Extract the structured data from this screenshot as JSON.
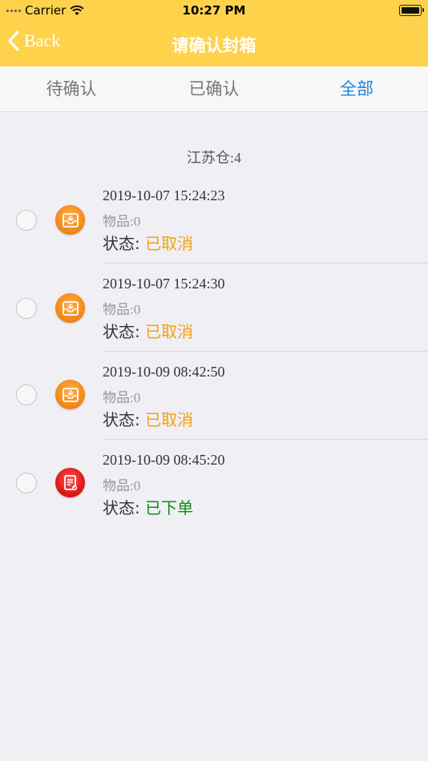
{
  "status_bar": {
    "carrier": "Carrier",
    "time": "10:27 PM"
  },
  "nav": {
    "back_label": "Back",
    "title": "请确认封箱"
  },
  "tabs": [
    {
      "label": "待确认",
      "active": false
    },
    {
      "label": "已确认",
      "active": false
    },
    {
      "label": "全部",
      "active": true
    }
  ],
  "group": {
    "header": "江苏仓:4"
  },
  "status_prefix": "状态:",
  "orders": [
    {
      "datetime": "2019-10-07 15:24:23",
      "items": "物品:0",
      "status": "已取消",
      "icon": "inbox-icon"
    },
    {
      "datetime": "2019-10-07 15:24:30",
      "items": "物品:0",
      "status": "已取消",
      "icon": "inbox-icon"
    },
    {
      "datetime": "2019-10-09 08:42:50",
      "items": "物品:0",
      "status": "已取消",
      "icon": "inbox-icon"
    },
    {
      "datetime": "2019-10-09 08:45:20",
      "items": "物品:0",
      "status": "已下单",
      "icon": "order-document-icon"
    }
  ],
  "colors": {
    "accent": "#ffd24c",
    "tab_active": "#1a82e6",
    "status_cancelled": "#f5a10f",
    "status_ordered": "#109010"
  }
}
